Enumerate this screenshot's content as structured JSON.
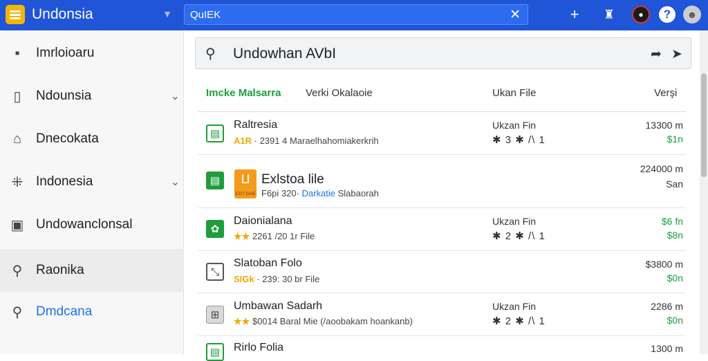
{
  "header": {
    "app_title": "Undonsia",
    "search_value": "QuIEK",
    "icons": [
      "menu-icon",
      "caret-down-icon",
      "close-icon",
      "add-icon",
      "store-icon",
      "account-icon",
      "help-icon",
      "avatar-icon"
    ]
  },
  "sidebar": {
    "items": [
      {
        "label": "Imrloioaru",
        "icon": "square-icon"
      },
      {
        "label": "Ndounsia",
        "icon": "document-icon"
      },
      {
        "label": "Dnecokata",
        "icon": "home-icon"
      },
      {
        "label": "Indonesia",
        "icon": "network-icon"
      },
      {
        "label": "Undowanclonsal",
        "icon": "image-icon"
      },
      {
        "label": "Raonika",
        "icon": "key-icon"
      },
      {
        "label": "Dmdcana",
        "icon": "search-icon"
      }
    ]
  },
  "main": {
    "search_value": "Undowhan AVbI",
    "columns": [
      "Imcke Malsarra",
      "Verki Okalaoie",
      "Ukan File",
      "Verşi"
    ],
    "rows": [
      {
        "name": "Raltresia",
        "rating": "A1R",
        "meta": "· 2391 4 Maraelhahomiakerkrih",
        "col3a": "Ukzan Fin",
        "col3b": "✱ 3 ✱ /\\ 1",
        "col4a": "13300 m",
        "col4b": "$1n"
      },
      {
        "name": "Exlstoa lile",
        "meta_prefix": "F6pi 320·",
        "meta_link": "Darkatie",
        "meta_suffix": "Slabaorah",
        "thumb_caption": "EXIT DAIE",
        "col4a": "224000 m",
        "col4b": "San"
      },
      {
        "name": "Daionialana",
        "rating": "★★",
        "meta": "2261 /20 1r File",
        "col3a": "Ukzan Fin",
        "col3b": "✱ 2 ✱ /\\ 1",
        "col4a": "$6 fn",
        "col4b": "$8n"
      },
      {
        "name": "Slatoban Folo",
        "rating": "SIGk",
        "meta": "· 239: 30 br File",
        "col4a": "$3800 m",
        "col4b": "$0n"
      },
      {
        "name": "Umbawan Sadarh",
        "rating": "★★",
        "meta": "$0014 Baral Mie (/aoobakam hoankanb)",
        "col3a": "Ukzan Fin",
        "col3b": "✱ 2 ✱ /\\ 1",
        "col4a": "2286 m",
        "col4b": "$0n"
      },
      {
        "name": "Rirlo Folia",
        "col4a": "1300 m"
      }
    ]
  },
  "colors": {
    "topbar": "#1f55d6",
    "accent_green": "#1b9e3e",
    "star": "#f2a600",
    "link_blue": "#1a73e8"
  }
}
